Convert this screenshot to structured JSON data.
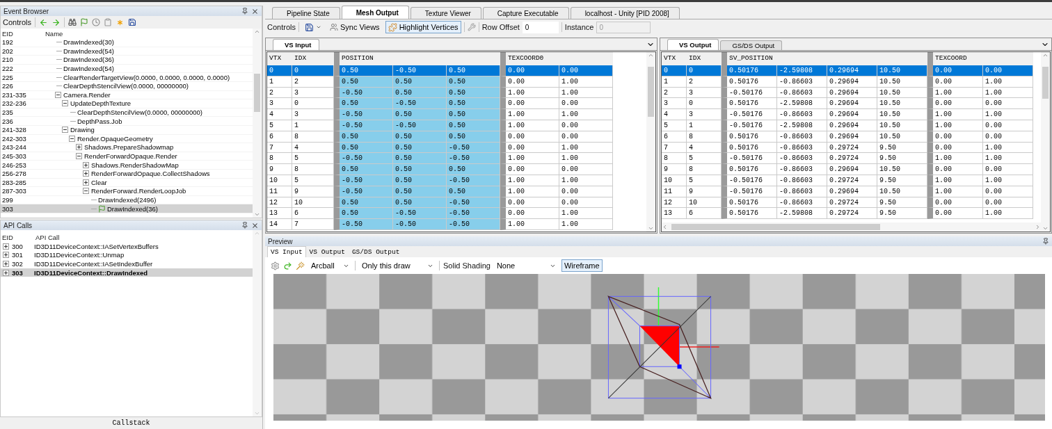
{
  "event_browser": {
    "title": "Event Browser",
    "controls_label": "Controls",
    "columns": [
      "EID",
      "Name"
    ],
    "items": [
      {
        "eid": "192",
        "name": "DrawIndexed(30)",
        "selected": false
      },
      {
        "eid": "202",
        "name": "DrawIndexed(54)",
        "selected": false
      },
      {
        "eid": "210",
        "name": "DrawIndexed(36)",
        "selected": false
      },
      {
        "eid": "222",
        "name": "DrawIndexed(54)",
        "selected": false
      },
      {
        "eid": "225",
        "name": "ClearRenderTargetView(0.0000, 0.0000, 0.0000, 0.0000)",
        "selected": false
      },
      {
        "eid": "226",
        "name": "ClearDepthStencilView(0.0000, 00000000)",
        "selected": false
      },
      {
        "eid": "231-335",
        "name": "Camera.Render",
        "selected": false,
        "expanded": true,
        "children": [
          {
            "eid": "232-236",
            "name": "UpdateDepthTexture",
            "selected": false,
            "expanded": true,
            "children": [
              {
                "eid": "235",
                "name": "ClearDepthStencilView(0.0000, 00000000)",
                "selected": false
              },
              {
                "eid": "236",
                "name": "DepthPass.Job",
                "selected": false
              }
            ]
          },
          {
            "eid": "241-328",
            "name": "Drawing",
            "selected": false,
            "expanded": true,
            "children": [
              {
                "eid": "242-303",
                "name": "Render.OpaqueGeometry",
                "selected": false,
                "expanded": true,
                "children": [
                  {
                    "eid": "243-244",
                    "name": "Shadows.PrepareShadowmap",
                    "selected": false,
                    "expanded": false
                  },
                  {
                    "eid": "245-303",
                    "name": "RenderForwardOpaque.Render",
                    "selected": false,
                    "expanded": true,
                    "children": [
                      {
                        "eid": "246-253",
                        "name": "Shadows.RenderShadowMap",
                        "selected": false,
                        "expanded": false
                      },
                      {
                        "eid": "256-278",
                        "name": "RenderForwardOpaque.CollectShadows",
                        "selected": false,
                        "expanded": false
                      },
                      {
                        "eid": "283-285",
                        "name": "Clear",
                        "selected": false,
                        "expanded": false
                      },
                      {
                        "eid": "287-303",
                        "name": "RenderForward.RenderLoopJob",
                        "selected": false,
                        "expanded": true,
                        "children": [
                          {
                            "eid": "299",
                            "name": "DrawIndexed(2496)",
                            "selected": false
                          },
                          {
                            "eid": "303",
                            "name": "DrawIndexed(36)",
                            "selected": true
                          }
                        ]
                      }
                    ]
                  }
                ]
              }
            ]
          }
        ]
      }
    ]
  },
  "api_calls": {
    "title": "API Calls",
    "columns": [
      "EID",
      "API Call"
    ],
    "rows": [
      {
        "eid": "300",
        "call": "ID3D11DeviceContext::IASetVertexBuffers",
        "expanded": false,
        "selected": false
      },
      {
        "eid": "301",
        "call": "ID3D11DeviceContext::Unmap",
        "expanded": false,
        "selected": false
      },
      {
        "eid": "302",
        "call": "ID3D11DeviceContext::IASetIndexBuffer",
        "expanded": false,
        "selected": false
      },
      {
        "eid": "303",
        "call": "ID3D11DeviceContext::DrawIndexed",
        "expanded": false,
        "selected": true
      }
    ]
  },
  "callstack": {
    "title": "Callstack"
  },
  "main_tabs": [
    {
      "label": "Pipeline State",
      "selected": false
    },
    {
      "label": "Mesh Output",
      "selected": true
    },
    {
      "label": "Texture Viewer",
      "selected": false
    },
    {
      "label": "Capture Executable",
      "selected": false
    },
    {
      "label": "localhost - Unity [PID 2008]",
      "selected": false
    }
  ],
  "toolbar": {
    "label": "Controls",
    "sync_views": "Sync Views",
    "highlight_vertices": {
      "label": "Highlight Vertices",
      "on": true
    },
    "row_offset": {
      "label": "Row Offset",
      "value": "0"
    },
    "instance": {
      "label": "Instance",
      "value": "0",
      "disabled": true
    }
  },
  "mesh_panels": [
    {
      "tabs": [
        {
          "label": "VS Input",
          "selected": true
        }
      ],
      "table": {
        "columns": [
          {
            "label": "VTX",
            "highlighted": false
          },
          {
            "label": "IDX",
            "highlighted": false
          },
          {
            "label": "POSITION",
            "highlighted": true
          },
          {
            "label": "TEXCOORD0",
            "highlighted": false
          }
        ],
        "rows": [
          {
            "cells": [
              [
                "0"
              ],
              [
                "0"
              ],
              [
                "0.50",
                "-0.50",
                "0.50"
              ],
              [
                "0.00",
                "0.00"
              ]
            ],
            "selected": true
          },
          {
            "cells": [
              [
                "1"
              ],
              [
                "2"
              ],
              [
                "0.50",
                "0.50",
                "0.50"
              ],
              [
                "0.00",
                "1.00"
              ]
            ],
            "selected": false
          },
          {
            "cells": [
              [
                "2"
              ],
              [
                "3"
              ],
              [
                "-0.50",
                "0.50",
                "0.50"
              ],
              [
                "1.00",
                "1.00"
              ]
            ],
            "selected": false
          },
          {
            "cells": [
              [
                "3"
              ],
              [
                "0"
              ],
              [
                "0.50",
                "-0.50",
                "0.50"
              ],
              [
                "0.00",
                "0.00"
              ]
            ],
            "selected": false
          },
          {
            "cells": [
              [
                "4"
              ],
              [
                "3"
              ],
              [
                "-0.50",
                "0.50",
                "0.50"
              ],
              [
                "1.00",
                "1.00"
              ]
            ],
            "selected": false
          },
          {
            "cells": [
              [
                "5"
              ],
              [
                "1"
              ],
              [
                "-0.50",
                "-0.50",
                "0.50"
              ],
              [
                "1.00",
                "0.00"
              ]
            ],
            "selected": false
          },
          {
            "cells": [
              [
                "6"
              ],
              [
                "8"
              ],
              [
                "0.50",
                "0.50",
                "0.50"
              ],
              [
                "0.00",
                "0.00"
              ]
            ],
            "selected": false
          },
          {
            "cells": [
              [
                "7"
              ],
              [
                "4"
              ],
              [
                "0.50",
                "0.50",
                "-0.50"
              ],
              [
                "0.00",
                "1.00"
              ]
            ],
            "selected": false
          },
          {
            "cells": [
              [
                "8"
              ],
              [
                "5"
              ],
              [
                "-0.50",
                "0.50",
                "-0.50"
              ],
              [
                "1.00",
                "1.00"
              ]
            ],
            "selected": false
          },
          {
            "cells": [
              [
                "9"
              ],
              [
                "8"
              ],
              [
                "0.50",
                "0.50",
                "0.50"
              ],
              [
                "0.00",
                "0.00"
              ]
            ],
            "selected": false
          },
          {
            "cells": [
              [
                "10"
              ],
              [
                "5"
              ],
              [
                "-0.50",
                "0.50",
                "-0.50"
              ],
              [
                "1.00",
                "1.00"
              ]
            ],
            "selected": false
          },
          {
            "cells": [
              [
                "11"
              ],
              [
                "9"
              ],
              [
                "-0.50",
                "0.50",
                "0.50"
              ],
              [
                "1.00",
                "0.00"
              ]
            ],
            "selected": false
          },
          {
            "cells": [
              [
                "12"
              ],
              [
                "10"
              ],
              [
                "0.50",
                "0.50",
                "-0.50"
              ],
              [
                "0.00",
                "0.00"
              ]
            ],
            "selected": false
          },
          {
            "cells": [
              [
                "13"
              ],
              [
                "6"
              ],
              [
                "0.50",
                "-0.50",
                "-0.50"
              ],
              [
                "0.00",
                "1.00"
              ]
            ],
            "selected": false
          },
          {
            "cells": [
              [
                "14"
              ],
              [
                "7"
              ],
              [
                "-0.50",
                "-0.50",
                "-0.50"
              ],
              [
                "1.00",
                "1.00"
              ]
            ],
            "selected": false
          }
        ]
      }
    },
    {
      "tabs": [
        {
          "label": "VS Output",
          "selected": true
        },
        {
          "label": "GS/DS Output",
          "selected": false
        }
      ],
      "table": {
        "columns": [
          {
            "label": "VTX",
            "highlighted": false
          },
          {
            "label": "IDX",
            "highlighted": false
          },
          {
            "label": "SV_POSITION",
            "highlighted": false
          },
          {
            "label": "TEXCOORD",
            "highlighted": false
          }
        ],
        "rows": [
          {
            "cells": [
              [
                "0"
              ],
              [
                "0"
              ],
              [
                "0.50176",
                "-2.59808",
                "0.29694",
                "10.50"
              ],
              [
                "0.00",
                "0.00"
              ]
            ],
            "selected": true
          },
          {
            "cells": [
              [
                "1"
              ],
              [
                "2"
              ],
              [
                "0.50176",
                "-0.86603",
                "0.29694",
                "10.50"
              ],
              [
                "0.00",
                "1.00"
              ]
            ],
            "selected": false
          },
          {
            "cells": [
              [
                "2"
              ],
              [
                "3"
              ],
              [
                "-0.50176",
                "-0.86603",
                "0.29694",
                "10.50"
              ],
              [
                "1.00",
                "1.00"
              ]
            ],
            "selected": false
          },
          {
            "cells": [
              [
                "3"
              ],
              [
                "0"
              ],
              [
                "0.50176",
                "-2.59808",
                "0.29694",
                "10.50"
              ],
              [
                "0.00",
                "0.00"
              ]
            ],
            "selected": false
          },
          {
            "cells": [
              [
                "4"
              ],
              [
                "3"
              ],
              [
                "-0.50176",
                "-0.86603",
                "0.29694",
                "10.50"
              ],
              [
                "1.00",
                "1.00"
              ]
            ],
            "selected": false
          },
          {
            "cells": [
              [
                "5"
              ],
              [
                "1"
              ],
              [
                "-0.50176",
                "-2.59808",
                "0.29694",
                "10.50"
              ],
              [
                "1.00",
                "0.00"
              ]
            ],
            "selected": false
          },
          {
            "cells": [
              [
                "6"
              ],
              [
                "8"
              ],
              [
                "0.50176",
                "-0.86603",
                "0.29694",
                "10.50"
              ],
              [
                "0.00",
                "0.00"
              ]
            ],
            "selected": false
          },
          {
            "cells": [
              [
                "7"
              ],
              [
                "4"
              ],
              [
                "0.50176",
                "-0.86603",
                "0.29724",
                "9.50"
              ],
              [
                "0.00",
                "1.00"
              ]
            ],
            "selected": false
          },
          {
            "cells": [
              [
                "8"
              ],
              [
                "5"
              ],
              [
                "-0.50176",
                "-0.86603",
                "0.29724",
                "9.50"
              ],
              [
                "1.00",
                "1.00"
              ]
            ],
            "selected": false
          },
          {
            "cells": [
              [
                "9"
              ],
              [
                "8"
              ],
              [
                "0.50176",
                "-0.86603",
                "0.29694",
                "10.50"
              ],
              [
                "0.00",
                "0.00"
              ]
            ],
            "selected": false
          },
          {
            "cells": [
              [
                "10"
              ],
              [
                "5"
              ],
              [
                "-0.50176",
                "-0.86603",
                "0.29724",
                "9.50"
              ],
              [
                "1.00",
                "1.00"
              ]
            ],
            "selected": false
          },
          {
            "cells": [
              [
                "11"
              ],
              [
                "9"
              ],
              [
                "-0.50176",
                "-0.86603",
                "0.29694",
                "10.50"
              ],
              [
                "1.00",
                "0.00"
              ]
            ],
            "selected": false
          },
          {
            "cells": [
              [
                "12"
              ],
              [
                "10"
              ],
              [
                "0.50176",
                "-0.86603",
                "0.29724",
                "9.50"
              ],
              [
                "0.00",
                "0.00"
              ]
            ],
            "selected": false
          },
          {
            "cells": [
              [
                "13"
              ],
              [
                "6"
              ],
              [
                "0.50176",
                "-2.59808",
                "0.29724",
                "9.50"
              ],
              [
                "0.00",
                "1.00"
              ]
            ],
            "selected": false
          }
        ]
      }
    }
  ],
  "preview": {
    "title": "Preview",
    "tabs": [
      {
        "label": "VS Input",
        "selected": true
      },
      {
        "label": "VS Output",
        "selected": false
      },
      {
        "label": "GS/DS Output",
        "selected": false
      }
    ],
    "camera": "Arcball",
    "draw_range": "Only this draw",
    "shading_label": "Solid Shading",
    "shading": "None",
    "wireframe": {
      "label": "Wireframe",
      "on": true
    }
  }
}
